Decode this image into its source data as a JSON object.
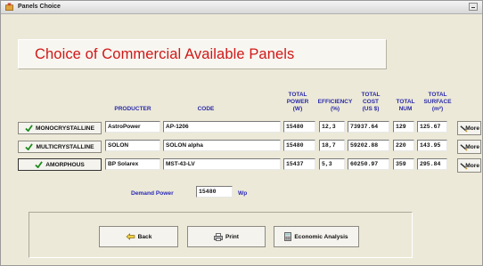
{
  "window": {
    "title": "Panels Choice"
  },
  "banner": {
    "text": "Choice of Commercial Available Panels"
  },
  "headers": {
    "producter": "PRODUCTER",
    "code": "CODE",
    "total_power": [
      "TOTAL",
      "POWER",
      "(W)"
    ],
    "efficiency": [
      "EFFICIENCY",
      "(%)"
    ],
    "total_cost": [
      "TOTAL",
      "COST",
      "(US $)"
    ],
    "total_num": [
      "TOTAL",
      "NUM"
    ],
    "total_surface": [
      "TOTAL",
      "SURFACE",
      "(m²)"
    ]
  },
  "rows": [
    {
      "type_label": "MONOCRYSTALLINE",
      "producter": "AstroPower",
      "code": "AP-1206",
      "power": "15480",
      "efficiency": "12,3",
      "cost": "73937.64",
      "num": "129",
      "surface": "125.67",
      "more_label": "More"
    },
    {
      "type_label": "MULTICRYSTALLINE",
      "producter": "SOLON",
      "code": "SOLON alpha",
      "power": "15480",
      "efficiency": "18,7",
      "cost": "59202.88",
      "num": "220",
      "surface": "143.95",
      "more_label": "More"
    },
    {
      "type_label": "AMORPHOUS",
      "producter": "BP Solarex",
      "code": "MST-43-LV",
      "power": "15437",
      "efficiency": "5,3",
      "cost": "60250.97",
      "num": "359",
      "surface": "295.84",
      "more_label": "More"
    }
  ],
  "selected_type": "AMORPHOUS",
  "demand": {
    "label": "Demand Power",
    "value": "15480",
    "unit": "Wp"
  },
  "buttons": {
    "back": "Back",
    "print": "Print",
    "economic": "Economic Analysis"
  },
  "icons": [
    "app-icon",
    "minimize-icon",
    "checkmark-icon",
    "pencil-icon",
    "back-arrow-icon",
    "printer-icon",
    "calculator-icon"
  ],
  "colors": {
    "banner_text": "#d01818",
    "header_text": "#2a2aa8",
    "check": "#1a8a1a",
    "background": "#ece9d8"
  }
}
